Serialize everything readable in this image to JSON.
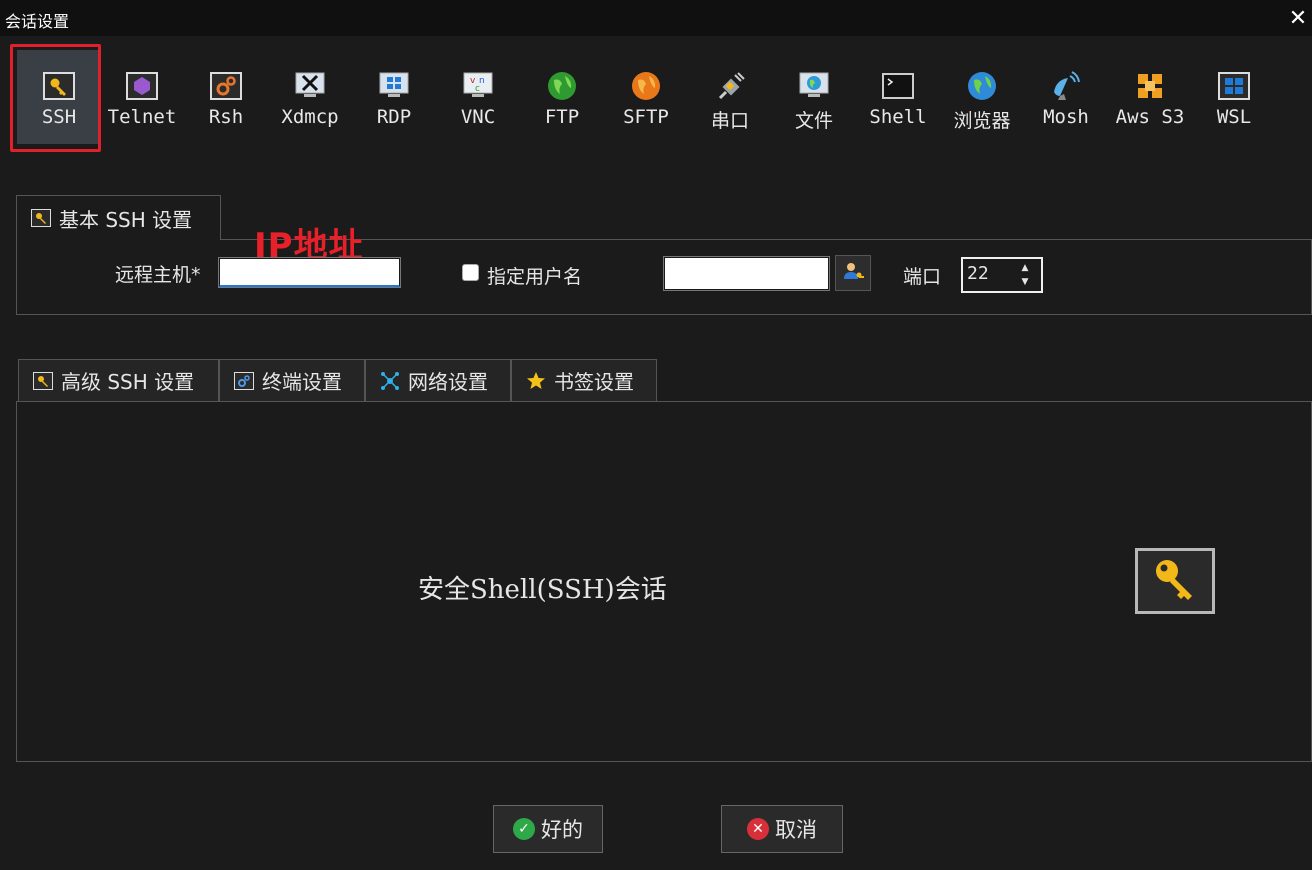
{
  "window": {
    "title": "会话设置",
    "close_glyph": "✕"
  },
  "protocols": [
    {
      "label": "SSH",
      "icon": "key-icon",
      "selected": true
    },
    {
      "label": "Telnet",
      "icon": "gem-icon"
    },
    {
      "label": "Rsh",
      "icon": "gears-icon"
    },
    {
      "label": "Xdmcp",
      "icon": "x-monitor-icon"
    },
    {
      "label": "RDP",
      "icon": "windows-monitor-icon"
    },
    {
      "label": "VNC",
      "icon": "vnc-monitor-icon"
    },
    {
      "label": "FTP",
      "icon": "globe-green-icon"
    },
    {
      "label": "SFTP",
      "icon": "globe-orange-icon"
    },
    {
      "label": "串口",
      "icon": "plug-icon"
    },
    {
      "label": "文件",
      "icon": "file-monitor-icon"
    },
    {
      "label": "Shell",
      "icon": "terminal-icon"
    },
    {
      "label": "浏览器",
      "icon": "globe-blue-icon"
    },
    {
      "label": "Mosh",
      "icon": "satellite-icon"
    },
    {
      "label": "Aws S3",
      "icon": "cubes-icon"
    },
    {
      "label": "WSL",
      "icon": "windows-icon"
    }
  ],
  "basic_tab": {
    "label": "基本 SSH 设置"
  },
  "form": {
    "remote_host_label": "远程主机*",
    "remote_host_value": "",
    "username_checkbox_label": "指定用户名",
    "username_checked": false,
    "username_value": "",
    "port_label": "端口",
    "port_value": "22"
  },
  "annotation": "IP地址",
  "advanced_tabs": [
    {
      "label": "高级 SSH 设置",
      "icon": "key-icon"
    },
    {
      "label": "终端设置",
      "icon": "gears-icon"
    },
    {
      "label": "网络设置",
      "icon": "network-icon"
    },
    {
      "label": "书签设置",
      "icon": "star-icon"
    }
  ],
  "description": "安全Shell(SSH)会话",
  "buttons": {
    "ok": "好的",
    "cancel": "取消"
  },
  "colors": {
    "highlight": "#e0202a",
    "background": "#1b1b1b"
  }
}
